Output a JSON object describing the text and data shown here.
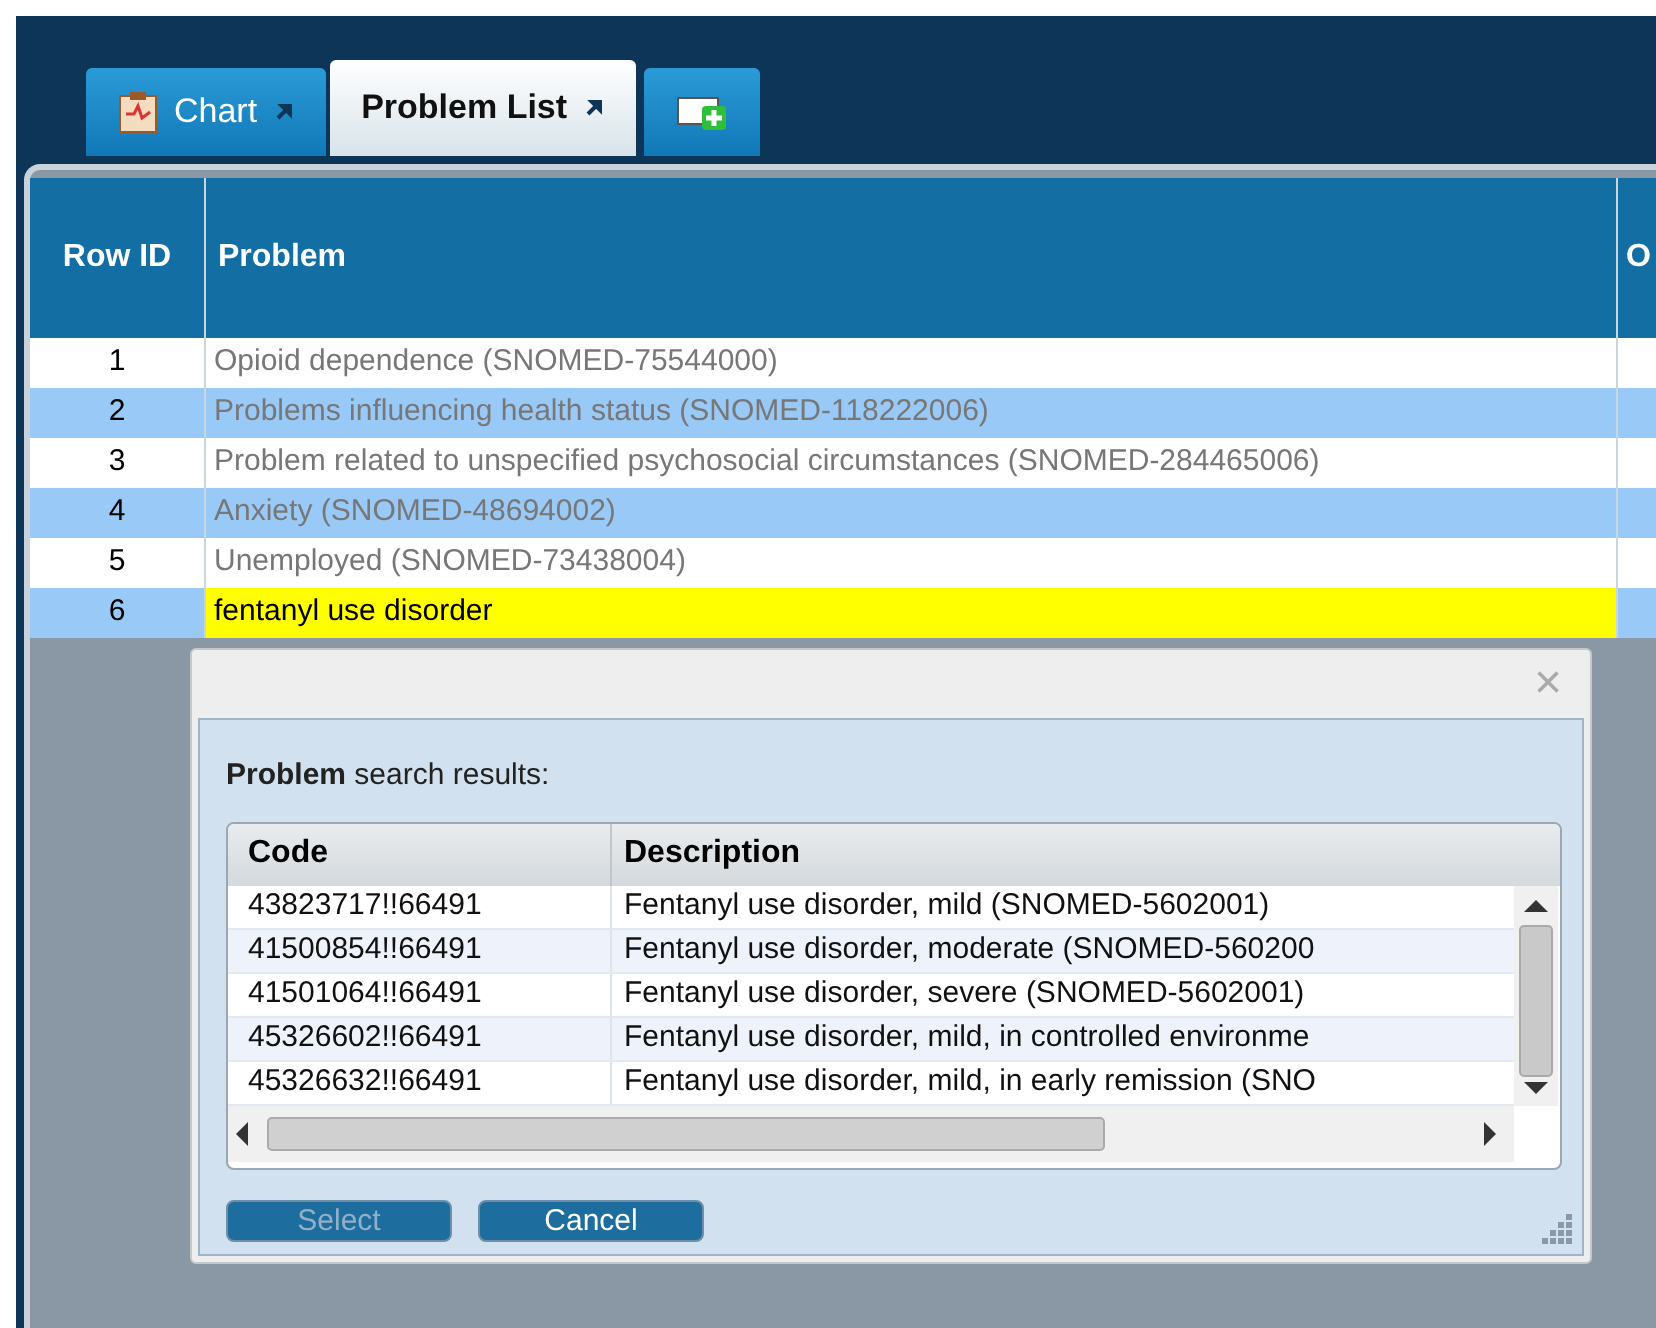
{
  "tabs": [
    {
      "kind": "chart",
      "label": "Chart",
      "selected": false
    },
    {
      "kind": "list",
      "label": "Problem List",
      "selected": true
    },
    {
      "kind": "add",
      "selected": false
    }
  ],
  "table": {
    "columns": [
      "Row ID",
      "Problem",
      "O"
    ],
    "rows": [
      {
        "row_id": "1",
        "problem": "Opioid dependence (SNOMED-75544000)",
        "editing": false
      },
      {
        "row_id": "2",
        "problem": "Problems influencing health status (SNOMED-118222006)",
        "editing": false
      },
      {
        "row_id": "3",
        "problem": "Problem related to unspecified psychosocial circumstances (SNOMED-284465006)",
        "editing": false
      },
      {
        "row_id": "4",
        "problem": "Anxiety (SNOMED-48694002)",
        "editing": false
      },
      {
        "row_id": "5",
        "problem": "Unemployed (SNOMED-73438004)",
        "editing": false
      },
      {
        "row_id": "6",
        "problem": "fentanyl use disorder",
        "editing": true
      }
    ]
  },
  "dialog": {
    "close": "×",
    "heading": "**Problem** search results:",
    "columns": [
      "Code",
      "Description"
    ],
    "rows": [
      {
        "code": "43823717!!66491",
        "description": "Fentanyl use disorder, mild (SNOMED-5602001)"
      },
      {
        "code": "41500854!!66491",
        "description": "Fentanyl use disorder, moderate (SNOMED-560200"
      },
      {
        "code": "41501064!!66491",
        "description": "Fentanyl use disorder, severe (SNOMED-5602001)"
      },
      {
        "code": "45326602!!66491",
        "description": "Fentanyl use disorder, mild, in controlled environme"
      },
      {
        "code": "45326632!!66491",
        "description": "Fentanyl use disorder, mild, in early remission (SNO"
      }
    ],
    "buttons": [
      {
        "label": "Select",
        "disabled": true
      },
      {
        "label": "Cancel",
        "disabled": false
      }
    ]
  }
}
